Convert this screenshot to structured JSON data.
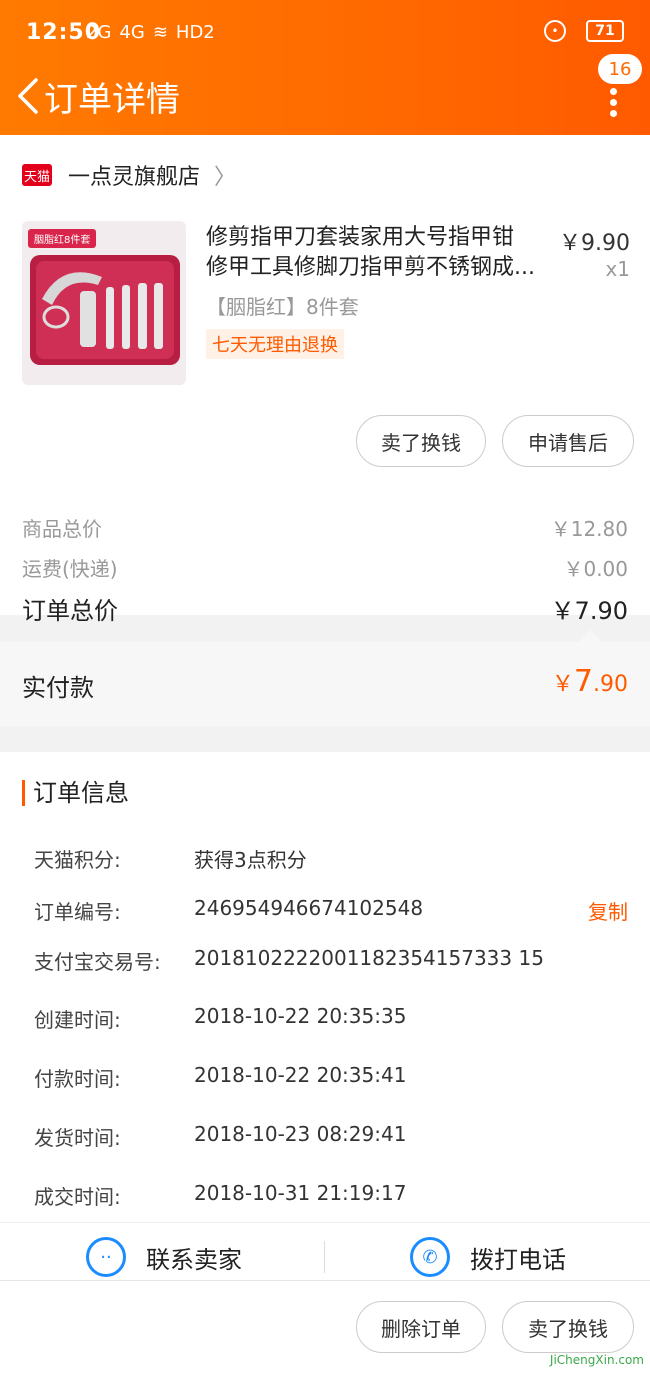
{
  "statusbar": {
    "time": "12:50",
    "sig1": "2G",
    "sig2": "4G",
    "hd": "HD2",
    "battery": "71"
  },
  "nav": {
    "title": "订单详情",
    "badge": "16"
  },
  "shop": {
    "tmall_badge": "天猫",
    "name": "一点灵旗舰店"
  },
  "product": {
    "image_tag": "胭脂红8件套",
    "title_line1": "修剪指甲刀套装家用大号指甲钳",
    "title_line2": "修甲工具修脚刀指甲剪不锈钢成...",
    "price": "￥9.90",
    "qty": "x1",
    "variant": "【胭脂红】8件套",
    "return_tag": "七天无理由退换"
  },
  "actions": {
    "sell_label": "卖了换钱",
    "aftersale_label": "申请售后"
  },
  "summary": {
    "goods_label": "商品总价",
    "goods_value": "￥12.80",
    "shipping_label": "运费(快递)",
    "shipping_value": "￥0.00",
    "total_label": "订单总价",
    "total_value": "￥7.90"
  },
  "paid": {
    "label": "实付款",
    "currency": "￥",
    "int": "7",
    "dec": ".90"
  },
  "order_info": {
    "title": "订单信息",
    "rows": [
      {
        "key": "天猫积分:",
        "value": "获得3点积分"
      },
      {
        "key": "订单编号:",
        "value": "246954946674102548"
      },
      {
        "key": "支付宝交易号:",
        "value": "2018102222001182354157333 15"
      },
      {
        "key": "创建时间:",
        "value": "2018-10-22 20:35:35"
      },
      {
        "key": "付款时间:",
        "value": "2018-10-22 20:35:41"
      },
      {
        "key": "发货时间:",
        "value": "2018-10-23 08:29:41"
      },
      {
        "key": "成交时间:",
        "value": "2018-10-31 21:19:17"
      }
    ],
    "copy_label": "复制"
  },
  "contact": {
    "seller_label": "联系卖家",
    "phone_label": "拨打电话"
  },
  "bottom": {
    "delete_label": "删除订单",
    "sell_label": "卖了换钱",
    "watermark": "JiChengXin.com"
  }
}
